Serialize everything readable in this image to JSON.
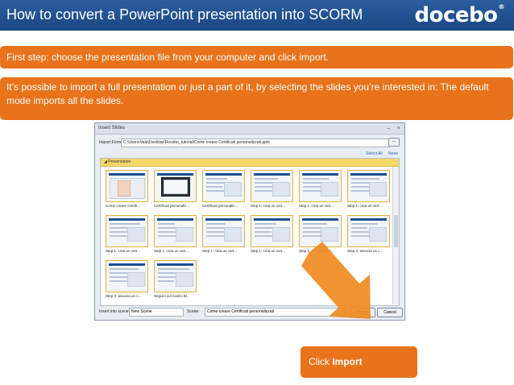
{
  "header": {
    "title": "How to convert a PowerPoint presentation into SCORM",
    "logo_text": "docebo",
    "logo_mark": "®",
    "bg_color": "#1f4f8f"
  },
  "callouts": {
    "step1": "First step: choose the presentation file from your computer and click import.",
    "step2": "It’s possible to import a full presentation or just a part of it, by selecting the slides you’re interested in: The default mode imports all the slides.",
    "click_prefix": "Click ",
    "click_bold": "Import",
    "color": "#e8731a"
  },
  "dialog": {
    "title": "Insert Slides",
    "minimize": "–",
    "close": "×",
    "import_from_label": "Import From:",
    "path": "C:\\Users\\Vale\\Desktop\\Docebo_tutorial\\Come creare Certificati personalizzati.pptx",
    "browse_label": "...",
    "select_all": "Select All",
    "select_none": "None",
    "group_label": "Presentation",
    "slides": [
      {
        "caption": "Come creare Certifi..."
      },
      {
        "caption": "Certificati personaliz..."
      },
      {
        "caption": "Certificati personaliz..."
      },
      {
        "caption": "Step 1: crea un cert..."
      },
      {
        "caption": "Step 1: crea un cert..."
      },
      {
        "caption": "Step 1: crea un cert..."
      },
      {
        "caption": "Step 1: crea un cert..."
      },
      {
        "caption": "Step 1: crea un cert..."
      },
      {
        "caption": "Step 1: crea un cert..."
      },
      {
        "caption": "Step 1: crea un cert..."
      },
      {
        "caption": "Step 2: associa un c..."
      },
      {
        "caption": "Step 2: associa un c..."
      },
      {
        "caption": "Step 2: associa un c..."
      },
      {
        "caption": "Seguici sul nostro Bl..."
      }
    ],
    "insert_into_scene_label": "Insert into scene:",
    "insert_into_scene_value": "New Scene",
    "scene_label": "Scene:",
    "scene_value": "Come creare Certificati personalizzati",
    "import_button": "Import",
    "cancel_button": "Cancel"
  }
}
